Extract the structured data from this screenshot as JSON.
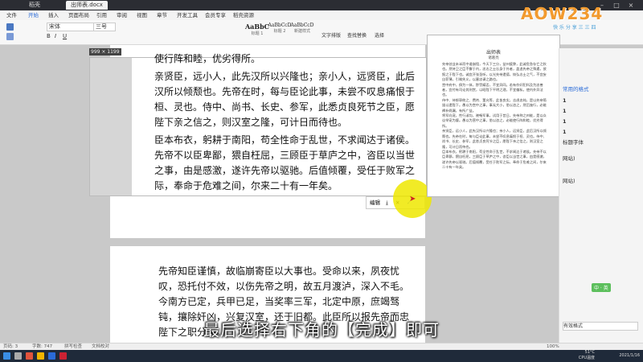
{
  "window": {
    "tabs": [
      "稻壳",
      "出师表.docx"
    ],
    "controls": [
      "minimize-icon",
      "maximize-icon",
      "close-icon"
    ]
  },
  "menu": {
    "items": [
      "文件",
      "开始",
      "插入",
      "页面布局",
      "引用",
      "审阅",
      "视图",
      "章节",
      "开发工具",
      "会员专享",
      "稻壳资源"
    ],
    "active_index": 1
  },
  "ribbon": {
    "font_name": "宋体",
    "font_size": "三号",
    "styles": [
      {
        "preview": "AaBbC",
        "name": "标题 1"
      },
      {
        "preview": "AaBbCcD",
        "name": "标题 2"
      },
      {
        "preview": "AaBbCcD",
        "name": "新建样式"
      }
    ],
    "right_tools": [
      "文字排版",
      "查找替换",
      "选择"
    ]
  },
  "capture": {
    "dimensions": "999 × 1199",
    "top_partial": "使行阵和睦，优劣得所。",
    "paragraphs": [
      "亲贤臣，远小人，此先汉所以兴隆也；亲小人，远贤臣，此后汉所以倾颓也。先帝在时，每与臣论此事，未尝不叹息痛恨于桓、灵也。侍中、尚书、长史、参军，此悉贞良死节之臣，愿陛下亲之信之，则汉室之隆，可计日而待也。",
      "臣本布衣，躬耕于南阳，苟全性命于乱世，不求闻达于诸侯。先帝不以臣卑鄙，猥自枉屈，三顾臣于草庐之中，咨臣以当世之事，由是感激，遂许先帝以驱驰。后值倾覆，受任于败军之际，奉命于危难之间，尔来二十有一年矣。"
    ],
    "toolbar": {
      "edit": "编辑",
      "save_icon": "download-icon",
      "cancel_icon": "close-icon",
      "done_icon": "check-icon"
    }
  },
  "preview": {
    "title": "出师表",
    "author": "诸葛亮",
    "lines": [
      "先帝创业未半而中道崩殂，今天下三分，益州疲弊，此诚危急存亡之秋也。然侍卫之臣不懈于内，忠志之士忘身于外者，盖追先帝之殊遇，欲报之于陛下也。诚宜开张圣听，以光先帝遗德，恢弘志士之气，不宜妄自菲薄，引喻失义，以塞忠谏之路也。",
      "宫中府中，俱为一体，陟罚臧否，不宜异同。若有作奸犯科及为忠善者，宜付有司论其刑赏，以昭陛下平明之理，不宜偏私，使内外异法也。",
      "侍中、侍郎郭攸之、费祎、董允等，此皆良实，志虑忠纯，是以先帝简拔以遗陛下。愚以为宫中之事，事无大小，悉以咨之，然后施行，必能裨补阙漏，有所广益。",
      "将军向宠，性行淑均，晓畅军事，试用于昔日，先帝称之曰能，是以众议举宠为督。愚以为营中之事，悉以咨之，必能使行阵和睦，优劣得所。",
      "亲贤臣，远小人，此先汉所以兴隆也；亲小人，远贤臣，此后汉所以倾颓也。先帝在时，每与臣论此事，未尝不叹息痛恨于桓、灵也。侍中、尚书、长史、参军，此悉贞良死节之臣，愿陛下亲之信之，则汉室之隆，可计日而待也。",
      "臣本布衣，躬耕于南阳，苟全性命于乱世，不求闻达于诸侯。先帝不以臣卑鄙，猥自枉屈，三顾臣于草庐之中，咨臣以当世之事，由是感激，遂许先帝以驱驰。后值倾覆，受任于败军之际，奉命于危难之间，尔来二十有一年矣。"
    ]
  },
  "sidebar": {
    "header": "",
    "items": [
      "常用的格式",
      "1",
      "1",
      "1",
      "1",
      "标题字体",
      "网站)",
      "网站)"
    ],
    "footer": "有效格式",
    "badge": "中 · 英"
  },
  "bottom_page": {
    "paragraphs": [
      "先帝知臣谨慎，故临崩寄臣以大事也。受命以来，夙夜忧叹，恐托付不效，以伤先帝之明，故五月渡泸，深入不毛。今南方已定，兵甲已足，当奖率三军，北定中原，庶竭驽钝，攘除奸凶，兴复汉室，还于旧都。此臣所以报先帝而忠陛下之职分也。"
    ]
  },
  "subtitle": "最后选择右下角的【完成】即可",
  "logo": {
    "text": "AOW234",
    "tagline": "快 乐 分 享 三 三 四"
  },
  "statusbar": {
    "page": "页码: 3",
    "words": "字数: 747",
    "spell": "拼写检查",
    "doc_check": "文档校对",
    "zoom": "100%"
  },
  "taskbar": {
    "temp": "51°C",
    "cpu": "CPU温度",
    "time": "2021/1/16"
  },
  "colors": {
    "accent": "#2a6bd8",
    "highlight": "#eee800",
    "subtitle": "#ffffff"
  }
}
